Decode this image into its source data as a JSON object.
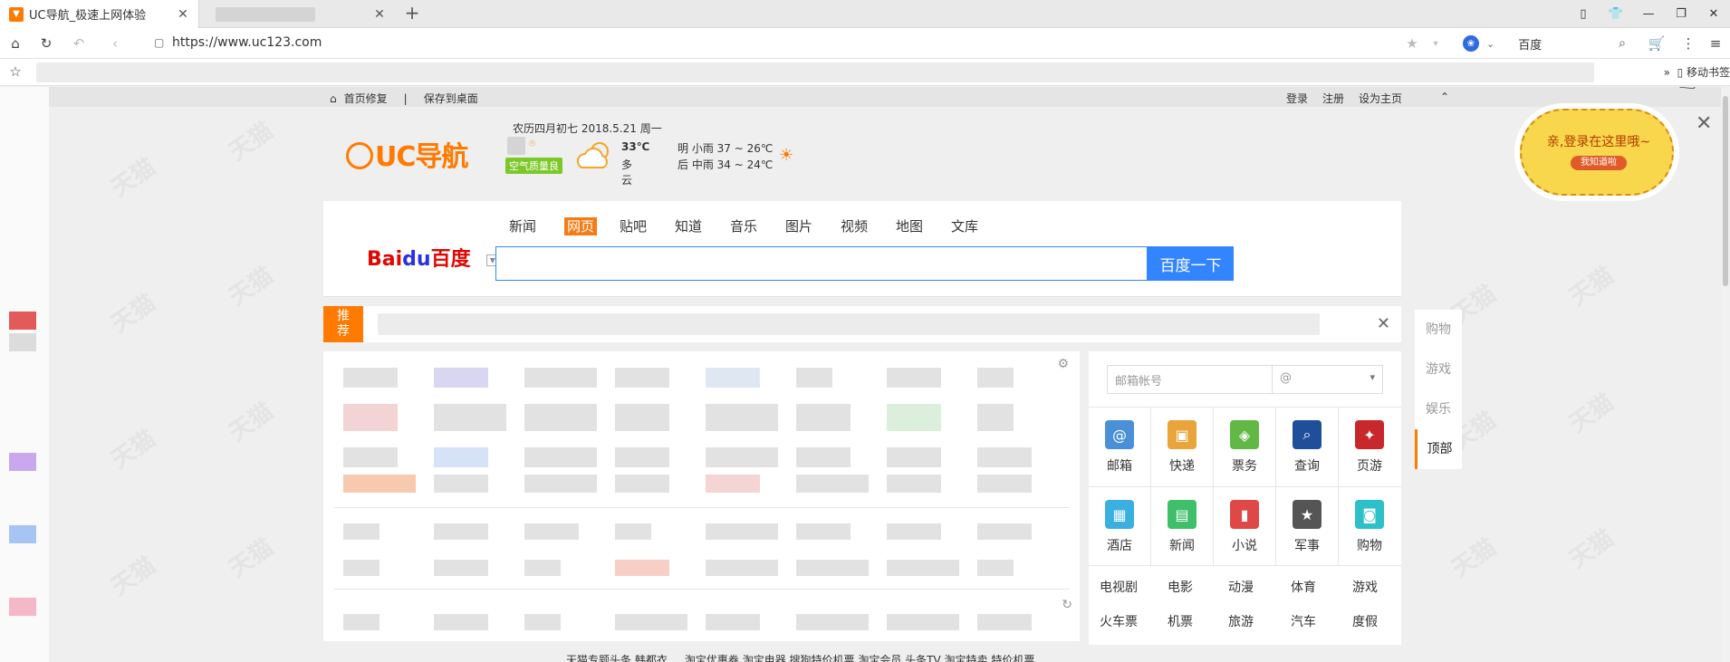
{
  "browser": {
    "tabs": [
      {
        "title": "UC导航_极速上网体验",
        "active": true
      },
      {
        "title": "",
        "active": false
      }
    ],
    "url": "https://www.uc123.com",
    "search_engine": "百度",
    "bookmarks_right": "移动书签"
  },
  "topbar": {
    "left": [
      "首页修复",
      "|",
      "保存到桌面"
    ],
    "right": [
      "登录",
      "注册",
      "设为主页"
    ]
  },
  "logo": {
    "text": "UC导航"
  },
  "weather": {
    "date": "农历四月初七  2018.5.21  周一",
    "air_quality": "空气质量良",
    "temp": "33℃",
    "condition": "多云",
    "forecast1": "明  小雨  37 ~ 26℃",
    "forecast2": "后  中雨  34 ~ 24℃"
  },
  "search": {
    "tabs": [
      "新闻",
      "网页",
      "贴吧",
      "知道",
      "音乐",
      "图片",
      "视频",
      "地图",
      "文库"
    ],
    "selected": "网页",
    "brand_left": "Bai",
    "brand_mid": "du",
    "brand_right": "百度",
    "button": "百度一下"
  },
  "recommend": {
    "tag_line1": "推",
    "tag_line2": "荐"
  },
  "mail": {
    "placeholder": "邮箱帐号",
    "domain": "@"
  },
  "services": [
    {
      "label": "邮箱",
      "icon": "mail-icon",
      "color": "#4a90d9"
    },
    {
      "label": "快递",
      "icon": "package-icon",
      "color": "#e9a43a"
    },
    {
      "label": "票务",
      "icon": "ticket-icon",
      "color": "#62b845"
    },
    {
      "label": "查询",
      "icon": "magnifier-icon",
      "color": "#1f4f9a"
    },
    {
      "label": "页游",
      "icon": "game-icon",
      "color": "#c8282b"
    },
    {
      "label": "酒店",
      "icon": "hotel-icon",
      "color": "#3ab0e0"
    },
    {
      "label": "新闻",
      "icon": "news-icon",
      "color": "#3fbf6a"
    },
    {
      "label": "小说",
      "icon": "book-icon",
      "color": "#e04848"
    },
    {
      "label": "军事",
      "icon": "badge-icon",
      "color": "#555555"
    },
    {
      "label": "购物",
      "icon": "bag-icon",
      "color": "#2cc0c8"
    }
  ],
  "links": [
    [
      "电视剧",
      "电影",
      "动漫",
      "体育",
      "游戏"
    ],
    [
      "火车票",
      "机票",
      "旅游",
      "汽车",
      "度假"
    ]
  ],
  "sidenav": [
    "购物",
    "游戏",
    "娱乐",
    "顶部"
  ],
  "sidenav_active": "顶部",
  "bubble": {
    "text": "亲,登录在这里哦~",
    "button": "我知道啦"
  },
  "footer": "天猫专题头条  韩都衣 ...  淘宝优惠券  淘宝电器  搜狗特价机票  淘宝会员  头条TV  淘宝特卖  特价机票"
}
